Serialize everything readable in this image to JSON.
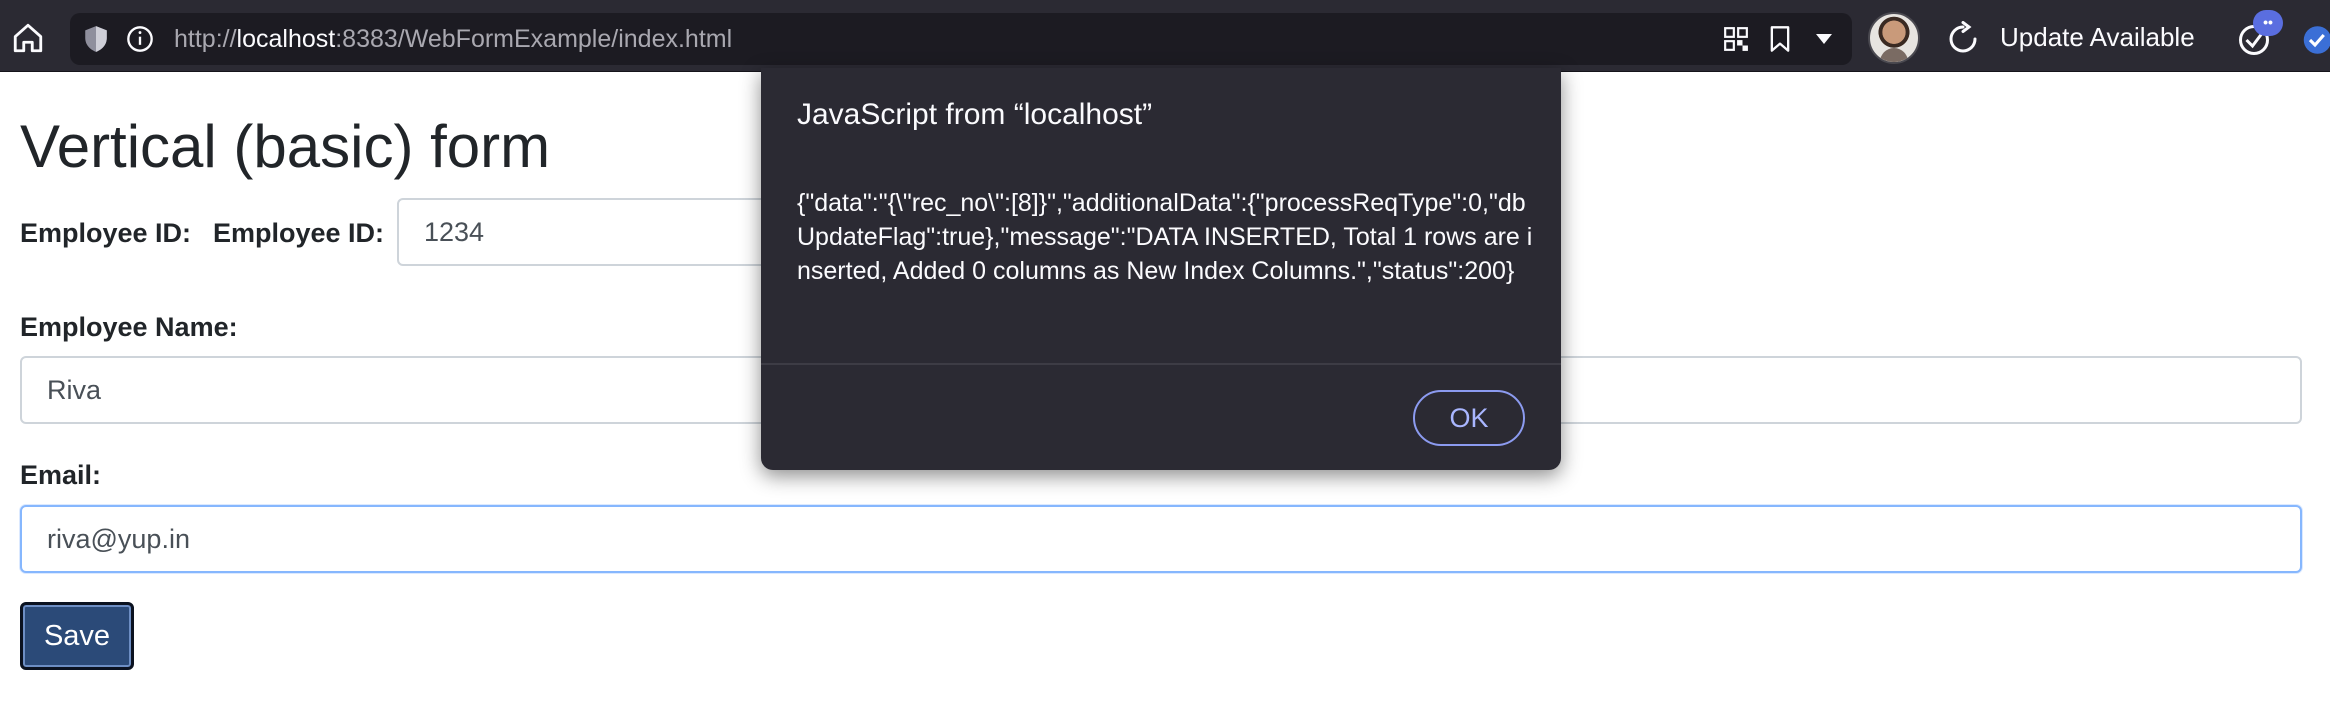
{
  "browser": {
    "url_prefix": "http://",
    "url_host": "localhost",
    "url_rest": ":8383/WebFormExample/index.html",
    "update_label": "Update Available",
    "notification_badge": "••"
  },
  "page": {
    "title": "Vertical (basic) form",
    "employee_id_label_1": "Employee ID:",
    "employee_id_label_2": "Employee ID:",
    "employee_id_value": "1234",
    "employee_name_label": "Employee Name:",
    "employee_name_value": "Riva",
    "email_label": "Email:",
    "email_value": "riva@yup.in",
    "save_label": "Save"
  },
  "dialog": {
    "title": "JavaScript from “localhost”",
    "message": "{\"data\":\"{\\\"rec_no\\\":[8]}\",\"additionalData\":{\"processReqType\":0,\"dbUpdateFlag\":true},\"message\":\"DATA INSERTED, Total 1 rows are inserted, Added 0 columns as New Index Columns.\",\"status\":200}",
    "ok_label": "OK"
  },
  "colors": {
    "toolbar_bg": "#2b2a33",
    "urlbar_bg": "#1c1b22",
    "dialog_bg": "#2b2a33",
    "save_button_bg": "#2b4a78",
    "ok_button_border": "#8c9bf0"
  }
}
